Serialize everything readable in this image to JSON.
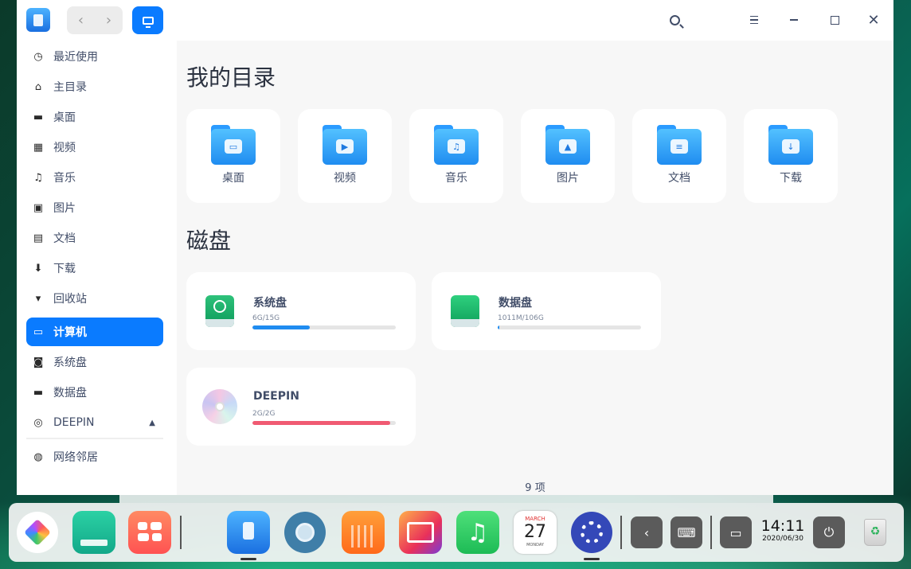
{
  "titlebar": {
    "nav_back": "‹",
    "nav_forward": "›",
    "close_glyph": "✕"
  },
  "sidebar": {
    "items": [
      {
        "label": "最近使用",
        "icon": "clock-icon"
      },
      {
        "label": "主目录",
        "icon": "home-icon"
      },
      {
        "label": "桌面",
        "icon": "desktop-icon"
      },
      {
        "label": "视频",
        "icon": "video-icon"
      },
      {
        "label": "音乐",
        "icon": "music-icon"
      },
      {
        "label": "图片",
        "icon": "picture-icon"
      },
      {
        "label": "文档",
        "icon": "document-icon"
      },
      {
        "label": "下载",
        "icon": "download-icon"
      },
      {
        "label": "回收站",
        "icon": "trash-icon"
      }
    ],
    "computer": {
      "label": "计算机",
      "icon": "computer-icon"
    },
    "disks": [
      {
        "label": "系统盘",
        "icon": "disk-icon"
      },
      {
        "label": "数据盘",
        "icon": "disk-icon"
      },
      {
        "label": "DEEPIN",
        "icon": "cdrom-icon"
      }
    ],
    "network": {
      "label": "网络邻居",
      "icon": "network-icon"
    }
  },
  "main": {
    "my_dirs_title": "我的目录",
    "dirs": [
      {
        "label": "桌面",
        "emblem": "▭"
      },
      {
        "label": "视频",
        "emblem": "▶"
      },
      {
        "label": "音乐",
        "emblem": "♫"
      },
      {
        "label": "图片",
        "emblem": "▲"
      },
      {
        "label": "文档",
        "emblem": "≡"
      },
      {
        "label": "下载",
        "emblem": "↓"
      }
    ],
    "disks_title": "磁盘",
    "disks": [
      {
        "name": "系统盘",
        "size": "6G/15G",
        "used_fraction": 0.4,
        "color": "#1f8cf0"
      },
      {
        "name": "数据盘",
        "size": "1011M/106G",
        "used_fraction": 0.01,
        "color": "#1f8cf0"
      },
      {
        "name": "DEEPIN",
        "size": "2G/2G",
        "used_fraction": 0.96,
        "color": "#f05a72"
      }
    ],
    "status": "9 项"
  },
  "dock": {
    "clock_time": "14:11",
    "clock_date": "2020/06/30",
    "tray_back": "‹",
    "apps": [
      "launcher-icon",
      "multitask-icon",
      "control-icon",
      "file-manager-icon",
      "browser-icon",
      "app-store-icon",
      "image-viewer-icon",
      "music-player-icon",
      "calendar-icon",
      "settings-icon"
    ],
    "calendar_month": "MARCH",
    "calendar_day": "27",
    "calendar_weekday": "MONDAY"
  }
}
